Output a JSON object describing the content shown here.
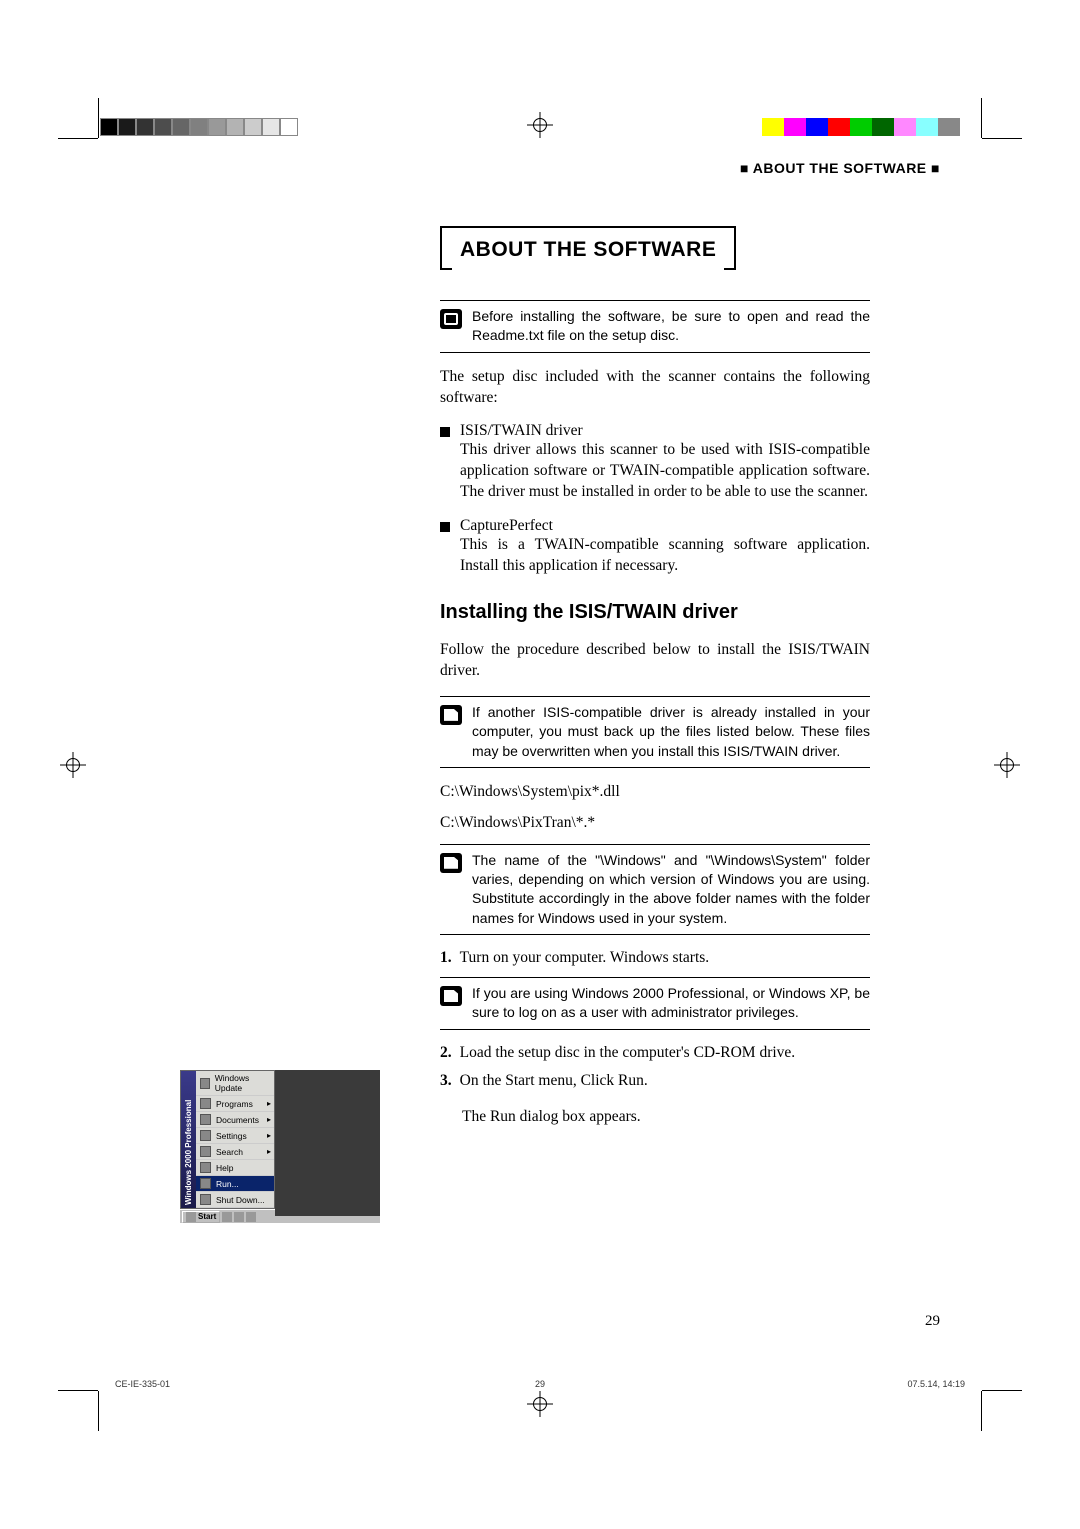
{
  "running_header": "■ ABOUT THE SOFTWARE ■",
  "main_heading": "ABOUT THE SOFTWARE",
  "intro_note": "Before installing the software, be sure to open and read the Readme.txt file on the setup disc.",
  "intro_paragraph": "The setup disc included with the scanner contains the following software:",
  "bullets": [
    {
      "title": "ISIS/TWAIN driver",
      "desc": "This driver allows this scanner to be used with ISIS-compatible application software or TWAIN-compatible application software. The driver must be installed in order to be able to use the scanner."
    },
    {
      "title": "CapturePerfect",
      "desc": "This is a TWAIN-compatible scanning software application. Install this application if necessary."
    }
  ],
  "subheading": "Installing the ISIS/TWAIN driver",
  "sub_intro": "Follow the procedure described below to install the ISIS/TWAIN driver.",
  "note1": "If another ISIS-compatible driver is already installed in your computer, you must back up the files listed below. These files may be overwritten when you install this ISIS/TWAIN driver.",
  "path1": "C:\\Windows\\System\\pix*.dll",
  "path2": "C:\\Windows\\PixTran\\*.*",
  "note2": "The name of the \"\\Windows\" and \"\\Windows\\System\" folder varies, depending on which version of Windows you are using. Substitute accordingly in the above folder names with the folder names for Windows used in your system.",
  "steps": [
    {
      "num": "1.",
      "text": "Turn on your computer. Windows starts."
    },
    {
      "num": "2.",
      "text": "Load the setup disc in the computer's CD-ROM drive."
    },
    {
      "num": "3.",
      "text": "On the Start menu, Click Run."
    }
  ],
  "step3_follow": "The Run dialog box appears.",
  "note_step1": "If you are using Windows 2000 Professional, or Windows XP, be sure to log on as a user with administrator privileges.",
  "start_menu": {
    "sideband": "Windows 2000 Professional",
    "items": [
      {
        "label": "Windows Update",
        "arrow": false
      },
      {
        "label": "Programs",
        "arrow": true
      },
      {
        "label": "Documents",
        "arrow": true
      },
      {
        "label": "Settings",
        "arrow": true
      },
      {
        "label": "Search",
        "arrow": true
      },
      {
        "label": "Help",
        "arrow": false
      },
      {
        "label": "Run...",
        "arrow": false,
        "highlight": true
      },
      {
        "label": "Shut Down...",
        "arrow": false
      }
    ],
    "taskbar_start": "Start"
  },
  "page_number": "29",
  "footer": {
    "left": "CE-IE-335-01",
    "center": "29",
    "right": "07.5.14, 14:19"
  }
}
